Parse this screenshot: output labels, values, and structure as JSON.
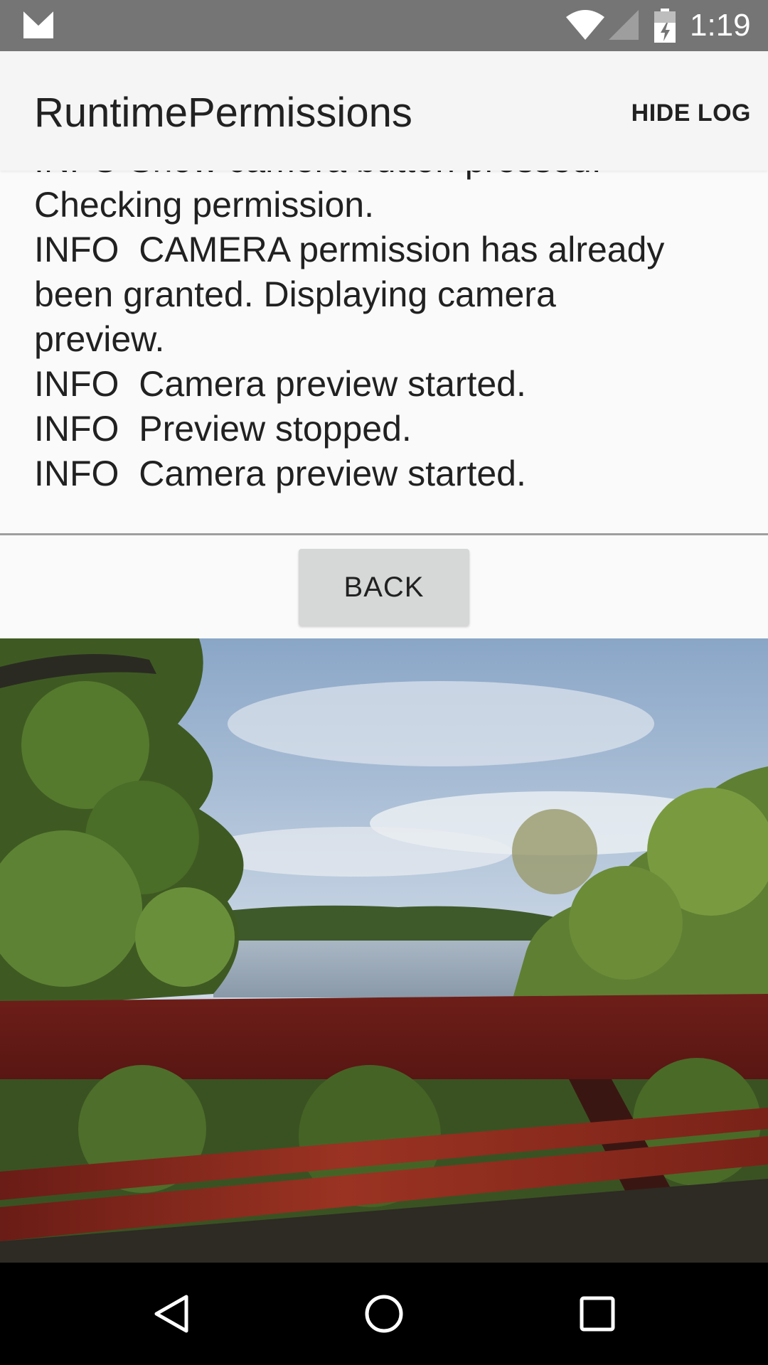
{
  "status_bar": {
    "time": "1:19",
    "icons": [
      "gmail-icon",
      "wifi-icon",
      "signal-icon",
      "battery-charging-icon"
    ],
    "background_color": "#757575"
  },
  "app_bar": {
    "title": "RuntimePermissions",
    "action_label": "HIDE LOG",
    "background_color": "#f5f5f5"
  },
  "log": {
    "lines": [
      "INFO Show camera button pressed.",
      "Checking permission.",
      "INFO  CAMERA permission has already",
      "been granted. Displaying camera",
      "preview.",
      "INFO  Camera preview started.",
      "INFO  Preview stopped.",
      "INFO  Camera preview started."
    ]
  },
  "back_button": {
    "label": "BACK"
  },
  "navigation_bar": {
    "icons": [
      "nav-back-icon",
      "nav-home-icon",
      "nav-recents-icon"
    ]
  }
}
